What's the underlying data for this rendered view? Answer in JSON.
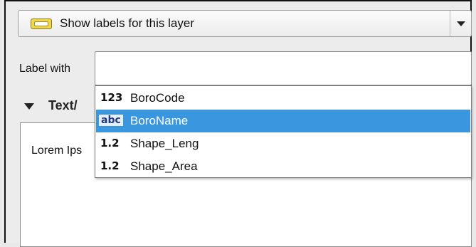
{
  "placement_mode": {
    "label": "Show labels for this layer",
    "icon": "label-abc-icon"
  },
  "label_with": {
    "label": "Label with",
    "value": ""
  },
  "section": {
    "title": "Text/"
  },
  "preview": {
    "text": "Lorem Ips"
  },
  "field_list": {
    "items": [
      {
        "type": "123",
        "name": "BoroCode",
        "selected": false
      },
      {
        "type": "abc",
        "name": "BoroName",
        "selected": true
      },
      {
        "type": "1.2",
        "name": "Shape_Leng",
        "selected": false
      },
      {
        "type": "1.2",
        "name": "Shape_Area",
        "selected": false
      }
    ]
  },
  "colors": {
    "selection": "#3996df",
    "background": "#ececec"
  }
}
